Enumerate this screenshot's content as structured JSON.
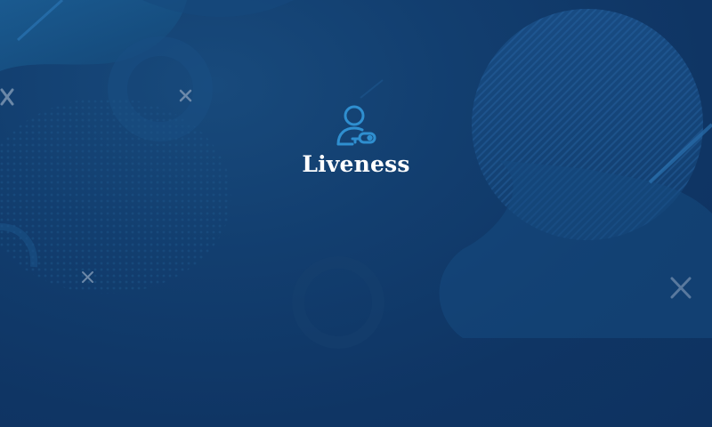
{
  "app": {
    "title": "Liveness",
    "logo_icon": "user-key-icon"
  },
  "colors": {
    "background": "#0f3564",
    "accent": "#2f8fd0",
    "title_text": "#ffffff",
    "decor_cross": "#7d95b3"
  }
}
